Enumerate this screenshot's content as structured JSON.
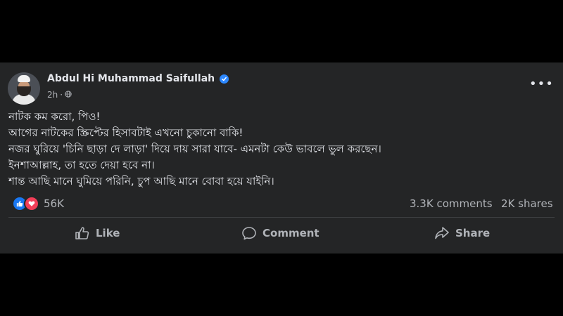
{
  "post": {
    "author": "Abdul Hi Muhammad Saifullah",
    "time": "2h",
    "separator": "·",
    "more_label": "•••",
    "lines": [
      "নাটক কম করো, পিও!",
      "আগের নাটকের স্ক্রিপ্টের হিসাবটাই এখনো চুকানো বাকি!",
      "নজর ঘুরিয়ে 'চিনি ছাড়া দে লাড়া' দিয়ে দায় সারা যাবে- এমনটা কেউ ভাবলে ভুল করছেন।",
      "ইনশাআল্লাহ, তা হতে দেয়া হবে না।",
      "শান্ত আছি মানে ঘুমিয়ে পরিনি, চুপ আছি মানে বোবা হয়ে যাইনি।"
    ]
  },
  "stats": {
    "reactions": "56K",
    "comments": "3.3K comments",
    "shares": "2K shares"
  },
  "actions": {
    "like": "Like",
    "comment": "Comment",
    "share": "Share"
  },
  "icons": {
    "verified": "verified-badge-icon",
    "globe": "globe-icon",
    "like_reaction": "thumbs-up-icon",
    "love_reaction": "heart-icon"
  },
  "colors": {
    "background": "#000000",
    "card": "#242526",
    "primary_text": "#e4e6eb",
    "secondary_text": "#b0b3b8",
    "like_blue": "#1877f2",
    "love_red": "#f33e58",
    "verified_blue": "#2d88ff"
  }
}
